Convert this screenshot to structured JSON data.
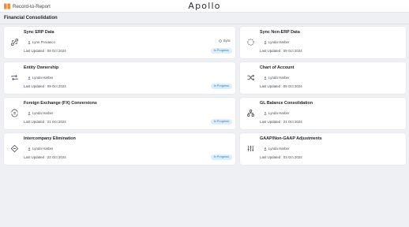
{
  "header": {
    "brand_label": "Record-to-Report",
    "app_title": "Apollo"
  },
  "section": {
    "title": "Financial Consolidation"
  },
  "colors": {
    "brand_accent": "#f08c2e",
    "badge_bg": "#dbeefc",
    "badge_text": "#2e7fc1"
  },
  "cards": [
    {
      "title": "Sync ERP Data",
      "owner": "Lynn Provasco",
      "updated": "Last Updated : 09 Oct 2024",
      "status": "In Progress",
      "action": "Sync",
      "icon": "link-sync-icon"
    },
    {
      "title": "Sync Non-ERP Data",
      "owner": "Lynda Harber",
      "updated": "Last Updated : 09 Oct 2024",
      "icon": "dashed-sync-icon"
    },
    {
      "title": "Entity Ownership",
      "owner": "Lynda Harber",
      "updated": "Last Updated : 09 Oct 2024",
      "status": "In Progress",
      "icon": "repeat-icon"
    },
    {
      "title": "Chart of Account",
      "owner": "Lynda Harber",
      "updated": "Last Updated : 09 Oct 2024",
      "icon": "shuffle-icon"
    },
    {
      "title": "Foreign Exchange (FX) Conversions",
      "owner": "Lynda Harber",
      "updated": "Last Updated : 21 Oct 2024",
      "status": "In Progress",
      "icon": "currency-exchange-icon"
    },
    {
      "title": "GL Balance Consolidation",
      "owner": "Lynda Harber",
      "updated": "Last Updated : 21 Oct 2024",
      "icon": "hierarchy-icon"
    },
    {
      "title": "Intercompany Elimination",
      "owner": "Lynda Harber",
      "updated": "Last Updated : 22 Oct 2024",
      "status": "In Progress",
      "icon": "diamond-minus-icon"
    },
    {
      "title": "GAAP/Non-GAAP Adjustments",
      "owner": "Lynda Harber",
      "updated": "Last Updated : 03 Oct 2024",
      "icon": "sliders-icon"
    }
  ]
}
